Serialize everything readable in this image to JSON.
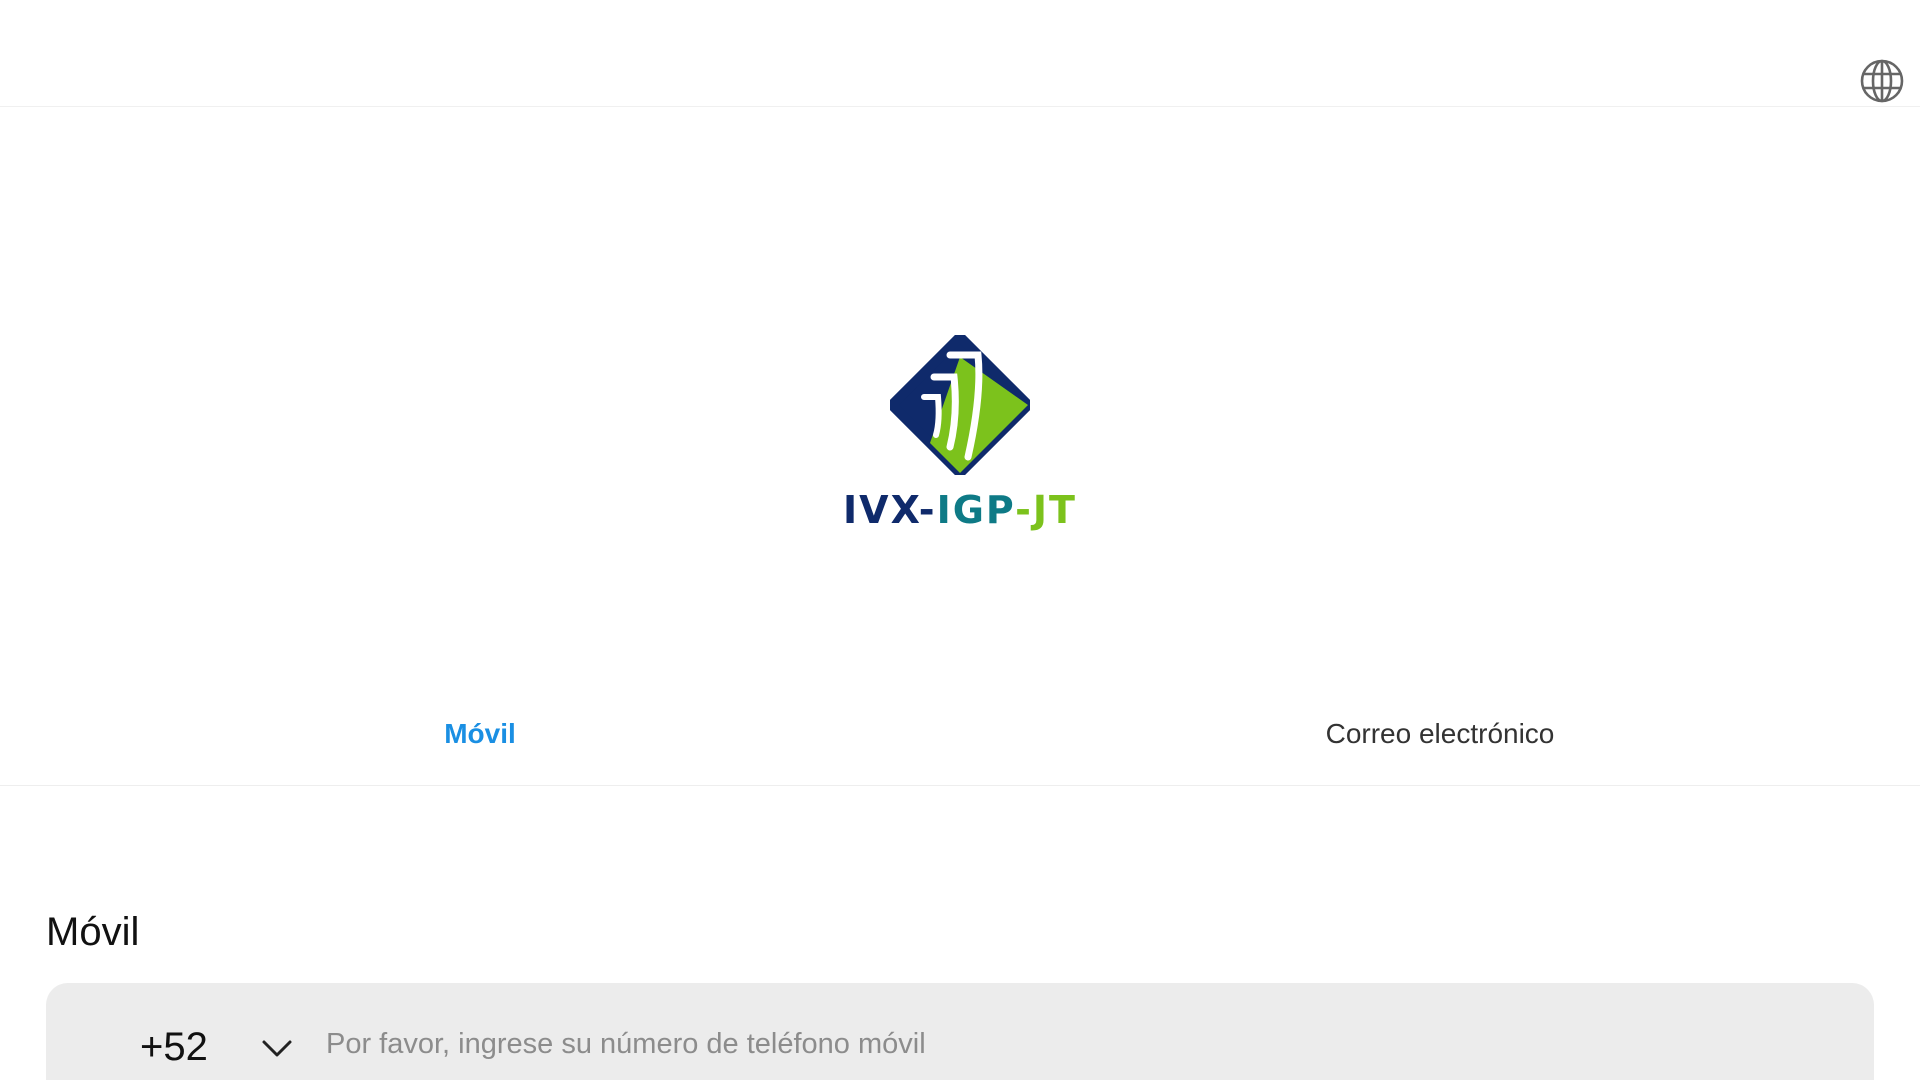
{
  "header": {
    "language_icon": "globe-icon"
  },
  "brand": {
    "name_part1": "IVX-",
    "name_part2": "IGP",
    "name_part3": "-JT",
    "colors": {
      "navy": "#0f2a6b",
      "teal": "#0e7a86",
      "green": "#7cc21c"
    }
  },
  "tabs": [
    {
      "label": "Móvil",
      "active": true
    },
    {
      "label": "Correo electrónico",
      "active": false
    }
  ],
  "form": {
    "field_label": "Móvil",
    "country_code": "+52",
    "country_chevron_icon": "chevron-down-icon",
    "phone_placeholder": "Por favor, ingrese su número de teléfono móvil",
    "phone_value": ""
  },
  "colors": {
    "accent": "#1a8fe3",
    "input_background": "#ececec"
  }
}
